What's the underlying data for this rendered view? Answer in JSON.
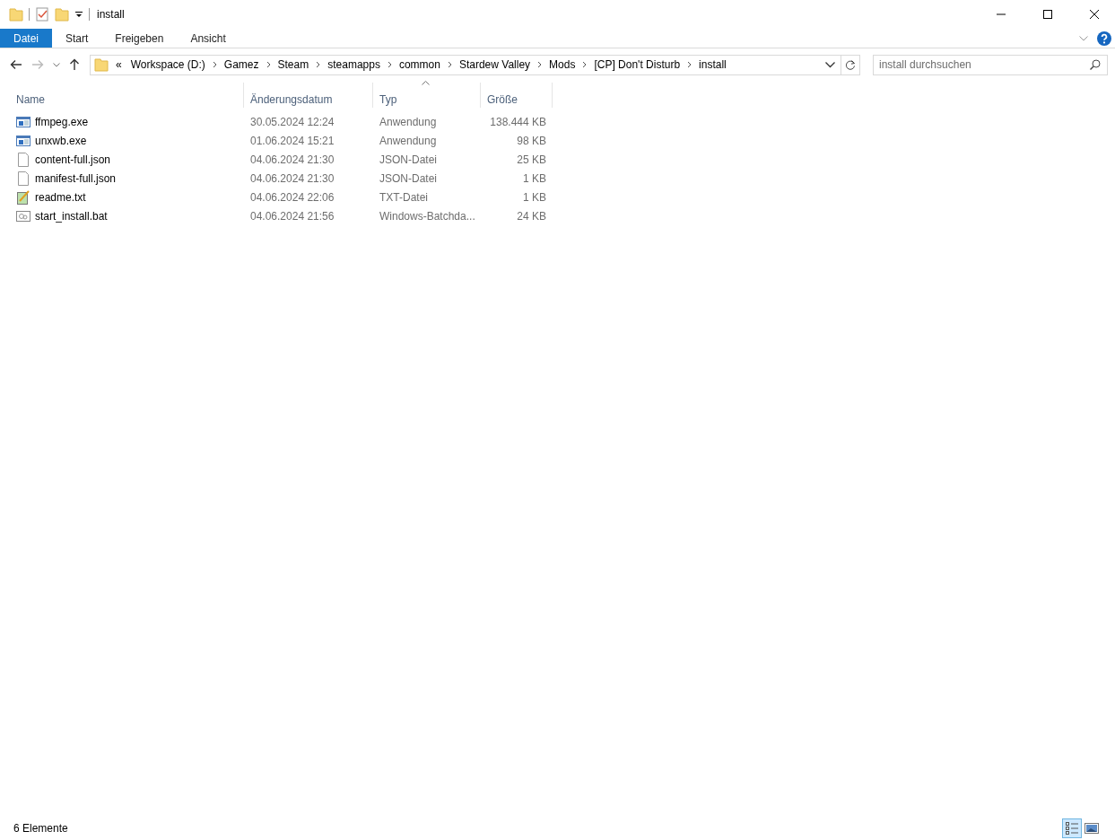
{
  "window": {
    "title": "install"
  },
  "ribbon_tabs": [
    {
      "label": "Datei",
      "selected": true
    },
    {
      "label": "Start",
      "selected": false
    },
    {
      "label": "Freigeben",
      "selected": false
    },
    {
      "label": "Ansicht",
      "selected": false
    }
  ],
  "address_bar": {
    "overflow_mark": "«",
    "path": [
      "Workspace (D:)",
      "Gamez",
      "Steam",
      "steamapps",
      "common",
      "Stardew Valley",
      "Mods",
      "[CP] Don't Disturb",
      "install"
    ]
  },
  "search": {
    "placeholder": "install durchsuchen"
  },
  "table": {
    "columns": [
      {
        "label": "Name",
        "sorted": false
      },
      {
        "label": "Änderungsdatum",
        "sorted": false
      },
      {
        "label": "Typ",
        "sorted": true
      },
      {
        "label": "Größe",
        "sorted": false
      }
    ],
    "rows": [
      {
        "kind": "app",
        "name": "ffmpeg.exe",
        "date": "30.05.2024 12:24",
        "type": "Anwendung",
        "size": "138.444 KB"
      },
      {
        "kind": "app",
        "name": "unxwb.exe",
        "date": "01.06.2024 15:21",
        "type": "Anwendung",
        "size": "98 KB"
      },
      {
        "kind": "file",
        "name": "content-full.json",
        "date": "04.06.2024 21:30",
        "type": "JSON-Datei",
        "size": "25 KB"
      },
      {
        "kind": "file",
        "name": "manifest-full.json",
        "date": "04.06.2024 21:30",
        "type": "JSON-Datei",
        "size": "1 KB"
      },
      {
        "kind": "text",
        "name": "readme.txt",
        "date": "04.06.2024 22:06",
        "type": "TXT-Datei",
        "size": "1 KB"
      },
      {
        "kind": "batch",
        "name": "start_install.bat",
        "date": "04.06.2024 21:56",
        "type": "Windows-Batchda...",
        "size": "24 KB"
      }
    ]
  },
  "status_bar": {
    "count": "6 Elemente",
    "views": [
      {
        "kind": "details",
        "selected": true
      },
      {
        "kind": "tiles",
        "selected": false
      }
    ]
  }
}
